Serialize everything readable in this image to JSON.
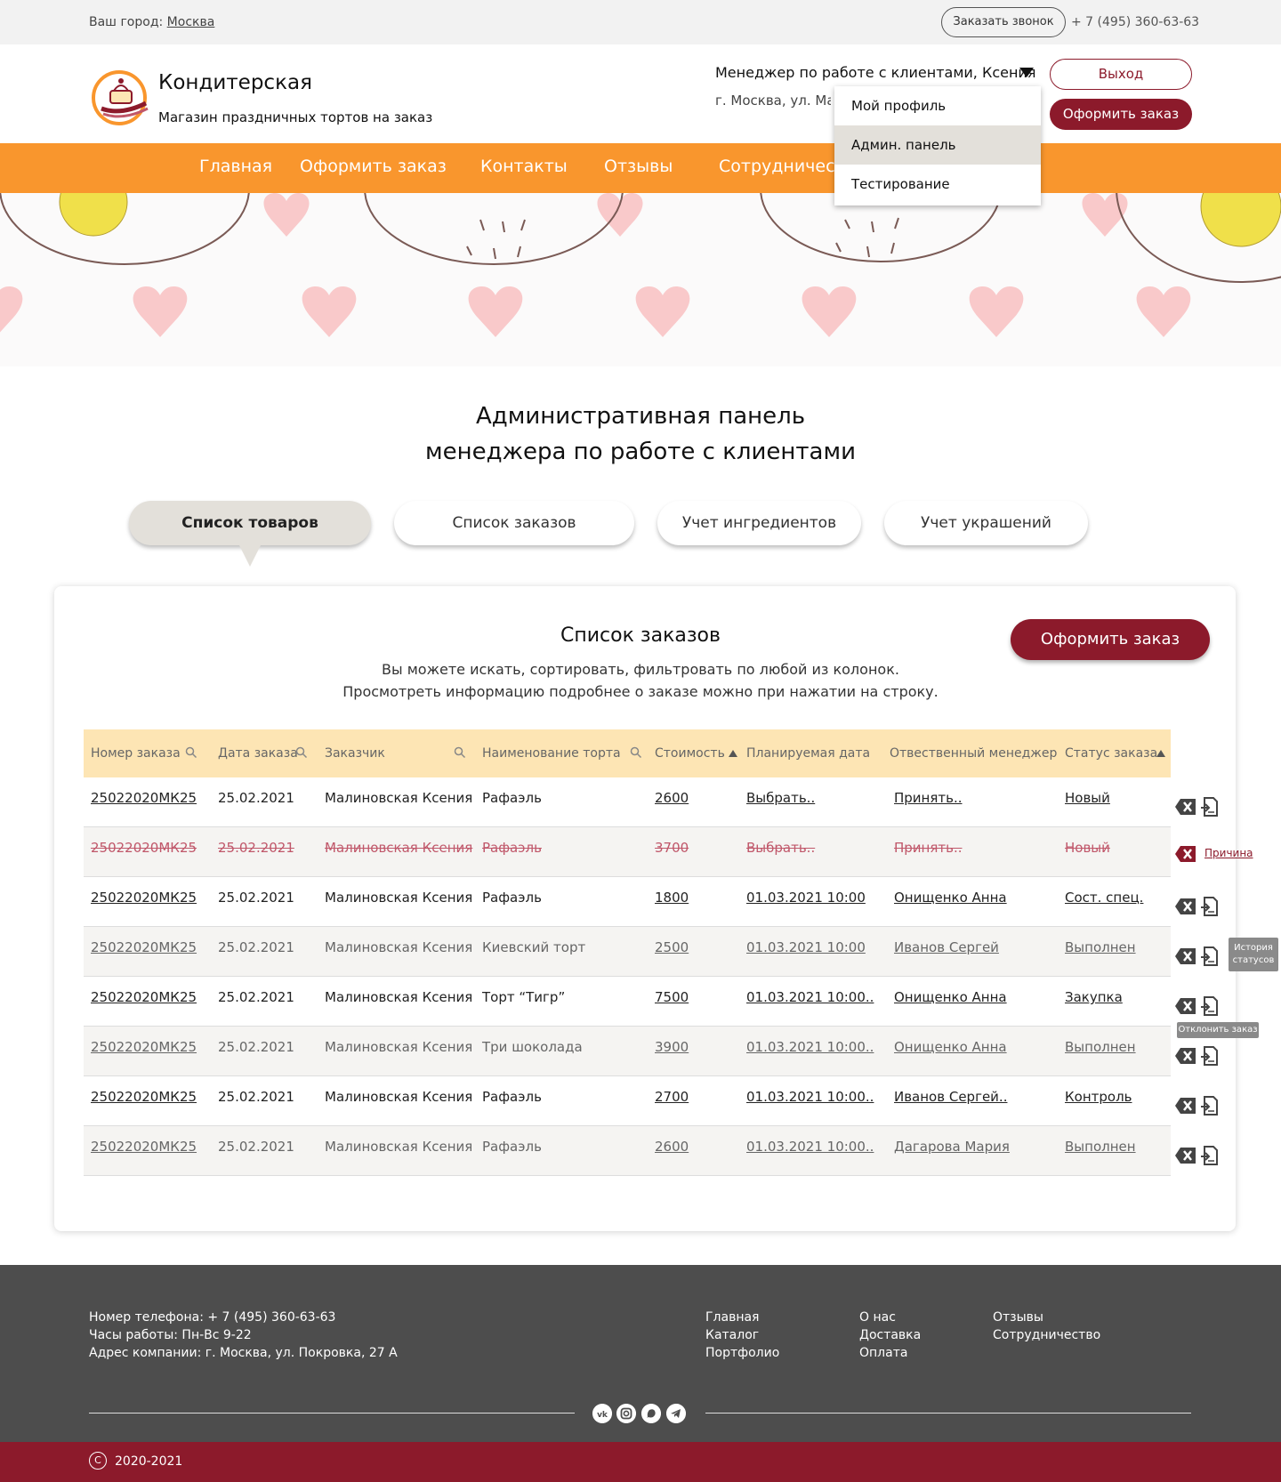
{
  "topbar": {
    "city_label": "Ваш город:",
    "city": "Москва",
    "callback_label": "Заказать звонок",
    "phone": "+ 7 (495) 360-63-63"
  },
  "header": {
    "brand_name": "Кондитерская",
    "brand_sub": "Магазин праздничных тортов на заказ",
    "manager": "Менеджер по работе с клиентами, Ксения",
    "address": "г. Москва, ул. Ма",
    "logout_label": "Выход",
    "order_label": "Оформить заказ"
  },
  "dropdown": {
    "items": [
      {
        "label": "Мой профиль"
      },
      {
        "label": "Админ. панель"
      },
      {
        "label": "Тестирование"
      }
    ]
  },
  "nav": {
    "items": [
      {
        "label": "Главная"
      },
      {
        "label": "Оформить заказ"
      },
      {
        "label": "Контакты"
      },
      {
        "label": "Отзывы"
      },
      {
        "label": "Сотрудничест"
      }
    ]
  },
  "page": {
    "title_line1": "Административная панель",
    "title_line2": "менеджера по работе с клиентами"
  },
  "tabs": [
    {
      "label": "Список товаров"
    },
    {
      "label": "Список заказов"
    },
    {
      "label": "Учет ингредиентов"
    },
    {
      "label": "Учет украшений"
    }
  ],
  "orders": {
    "title": "Список заказов",
    "desc_line1": "Вы можете искать, сортировать, фильтровать по любой из колонок.",
    "desc_line2": "Просмотреть информацию подробнее о заказе можно при нажатии на строку.",
    "order_button": "Оформить заказ",
    "columns": [
      "Номер заказа",
      "Дата заказа",
      "Заказчик",
      "Наименование торта",
      "Стоимость",
      "Планируемая дата",
      "Отвественный менеджер",
      "Статус заказа"
    ],
    "rows": [
      {
        "num": "25022020МК25",
        "date": "25.02.2021",
        "customer": "Малиновская Ксения",
        "cake": "Рафаэль",
        "price": "2600",
        "planned": "Выбрать..",
        "manager": "Принять..",
        "status": "Новый"
      },
      {
        "num": "25022020МК25",
        "date": "25.02.2021",
        "customer": "Малиновская Ксения",
        "cake": "Рафаэль",
        "price": "3700",
        "planned": "Выбрать..",
        "manager": "Принять..",
        "status": "Новый"
      },
      {
        "num": "25022020МК25",
        "date": "25.02.2021",
        "customer": "Малиновская Ксения",
        "cake": "Рафаэль",
        "price": "1800",
        "planned": "01.03.2021 10:00",
        "manager": "Онищенко Анна",
        "status": "Сост. спец."
      },
      {
        "num": "25022020МК25",
        "date": "25.02.2021",
        "customer": "Малиновская Ксения",
        "cake": "Киевский торт",
        "price": "2500",
        "planned": "01.03.2021 10:00",
        "manager": "Иванов Сергей",
        "status": "Выполнен"
      },
      {
        "num": "25022020МК25",
        "date": "25.02.2021",
        "customer": "Малиновская Ксения",
        "cake": "Торт “Тигр”",
        "price": "7500",
        "planned": "01.03.2021 10:00..",
        "manager": "Онищенко Анна",
        "status": "Закупка"
      },
      {
        "num": "25022020МК25",
        "date": "25.02.2021",
        "customer": "Малиновская Ксения",
        "cake": "Три шоколада",
        "price": "3900",
        "planned": "01.03.2021 10:00..",
        "manager": "Онищенко Анна",
        "status": "Выполнен"
      },
      {
        "num": "25022020МК25",
        "date": "25.02.2021",
        "customer": "Малиновская Ксения",
        "cake": "Рафаэль",
        "price": "2700",
        "planned": "01.03.2021 10:00..",
        "manager": "Иванов Сергей..",
        "status": "Контроль"
      },
      {
        "num": "25022020МК25",
        "date": "25.02.2021",
        "customer": "Малиновская Ксения",
        "cake": "Рафаэль",
        "price": "2600",
        "planned": "01.03.2021 10:00..",
        "manager": "Дагарова Мария",
        "status": "Выполнен"
      }
    ],
    "reason_label": "Причина",
    "tooltip_history_1": "История",
    "tooltip_history_2": "статусов",
    "tooltip_reject": "Отклонить заказ"
  },
  "footer": {
    "phone": "Номер телефона: + 7 (495) 360-63-63",
    "hours": "Часы работы: Пн-Вс 9-22",
    "address": "Адрес компании: г. Москва, ул. Покровка, 27 А",
    "links": [
      {
        "label": "Главная"
      },
      {
        "label": "Каталог"
      },
      {
        "label": "Портфолио"
      },
      {
        "label": "О нас"
      },
      {
        "label": "Доставка"
      },
      {
        "label": "Оплата"
      },
      {
        "label": "Отзывы"
      },
      {
        "label": "Сотрудничество"
      }
    ],
    "social": [
      "vk-icon",
      "instagram-icon",
      "whatsapp-icon",
      "telegram-icon"
    ],
    "copyright_symbol": "C",
    "copyright": "2020-2021"
  },
  "colors": {
    "accent": "#8c1a2b",
    "nav": "#f9962d",
    "table_header": "#fde5b4",
    "footer": "#4d4d4d"
  }
}
